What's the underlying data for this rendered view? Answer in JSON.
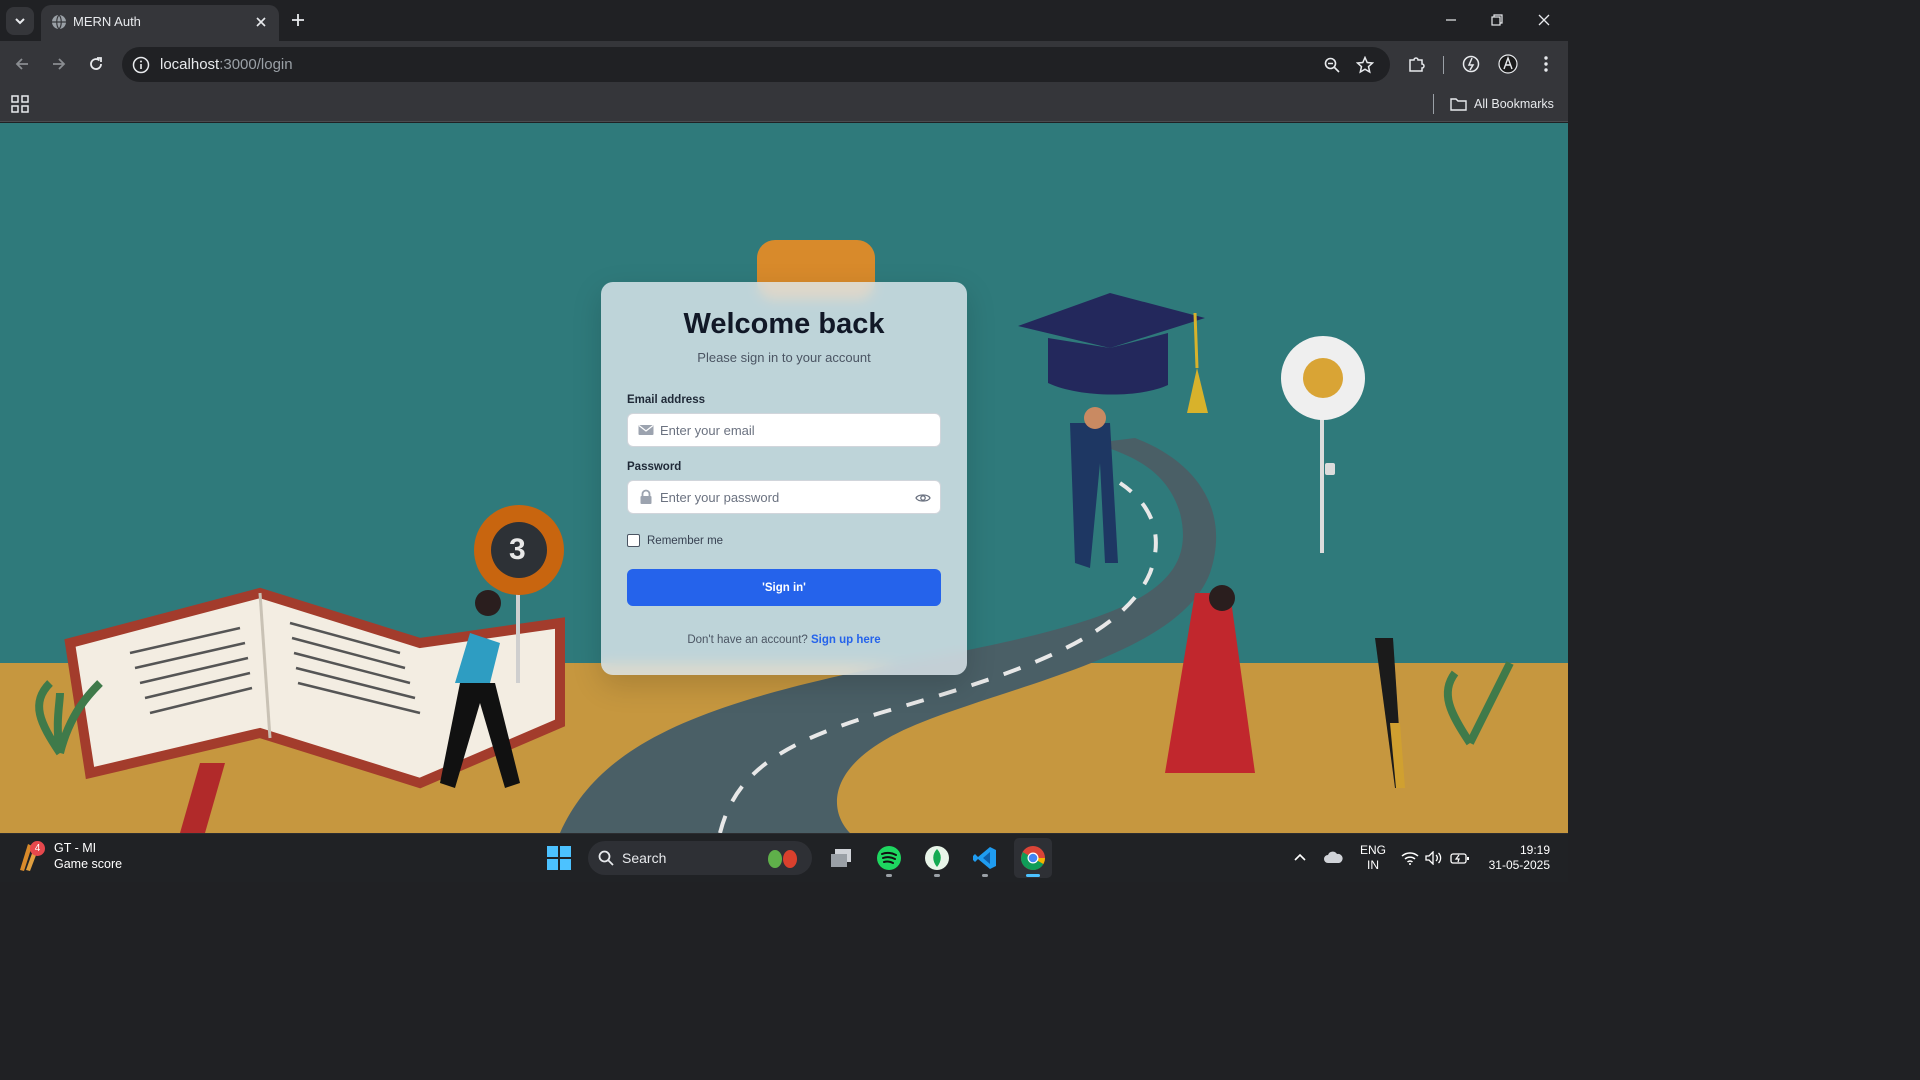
{
  "browser": {
    "tab_title": "MERN Auth",
    "url_host": "localhost",
    "url_path": ":3000/login",
    "bookmarks_all": "All Bookmarks"
  },
  "login": {
    "title": "Welcome back",
    "subtitle": "Please sign in to your account",
    "email_label": "Email address",
    "email_placeholder": "Enter your email",
    "password_label": "Password",
    "password_placeholder": "Enter your password",
    "remember_label": "Remember me",
    "remember_checked": false,
    "signin_label": "'Sign in'",
    "no_account_text": "Don't have an account?",
    "signup_link": "Sign up here"
  },
  "illustration": {
    "badge_number": "3"
  },
  "taskbar": {
    "widget_badge": "4",
    "widget_title": "GT - MI",
    "widget_subtitle": "Game score",
    "search_label": "Search",
    "lang_line1": "ENG",
    "lang_line2": "IN",
    "time": "19:19",
    "date": "31-05-2025"
  },
  "colors": {
    "accent": "#2563eb",
    "page_bg_teal": "#2e7d7d",
    "ground": "#c99a3e"
  }
}
